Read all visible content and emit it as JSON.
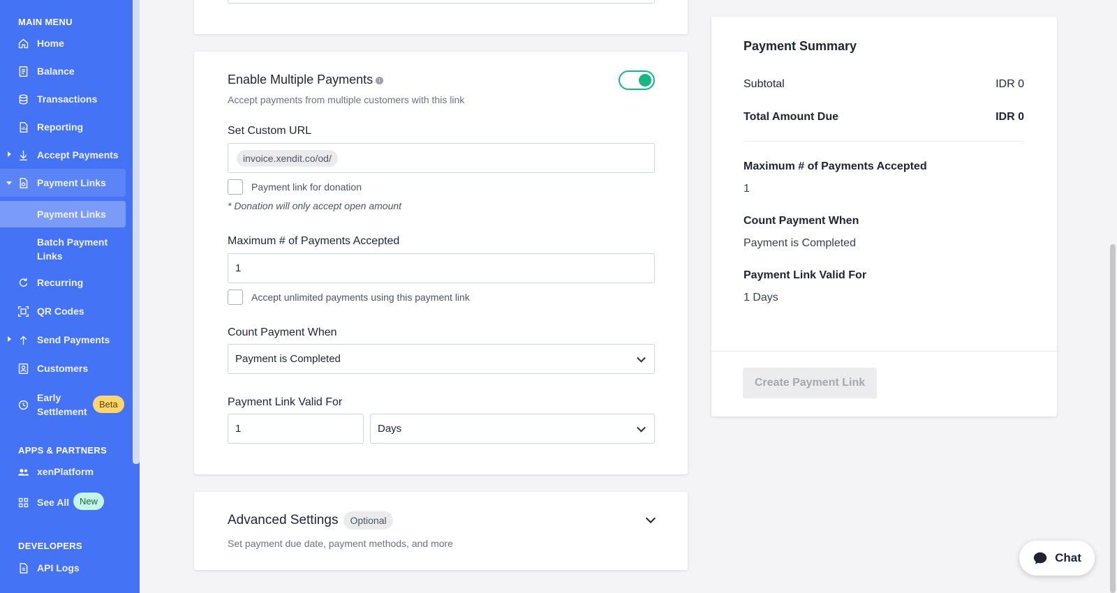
{
  "sidebar": {
    "main_menu_title": "MAIN MENU",
    "items": [
      {
        "label": "Home",
        "icon": "home-icon"
      },
      {
        "label": "Balance",
        "icon": "balance-icon"
      },
      {
        "label": "Transactions",
        "icon": "transactions-icon"
      },
      {
        "label": "Reporting",
        "icon": "reporting-icon"
      },
      {
        "label": "Accept Payments",
        "icon": "accept-payments-icon"
      },
      {
        "label": "Payment Links",
        "icon": "payment-links-icon"
      },
      {
        "label": "Recurring",
        "icon": "recurring-icon"
      },
      {
        "label": "QR Codes",
        "icon": "qr-code-icon"
      },
      {
        "label": "Send Payments",
        "icon": "send-payments-icon"
      },
      {
        "label": "Customers",
        "icon": "customers-icon"
      },
      {
        "label": "Early Settlement",
        "icon": "early-settlement-icon",
        "badge": "Beta"
      }
    ],
    "sub_items": [
      {
        "label": "Payment Links"
      },
      {
        "label": "Batch Payment Links"
      }
    ],
    "apps_title": "APPS & PARTNERS",
    "apps_items": [
      {
        "label": "xenPlatform",
        "icon": "users-icon"
      },
      {
        "label": "See All",
        "icon": "grid-icon",
        "badge": "New"
      }
    ],
    "developers_title": "DEVELOPERS",
    "developer_items": [
      {
        "label": "API Logs",
        "icon": "api-logs-icon"
      }
    ]
  },
  "form": {
    "multiple_payments": {
      "title": "Enable Multiple Payments",
      "description": "Accept payments from multiple customers with this link",
      "enabled": true
    },
    "custom_url": {
      "label": "Set Custom URL",
      "prefix": "invoice.xendit.co/od/",
      "value": ""
    },
    "donation": {
      "checkbox_label": "Payment link for donation",
      "note": "* Donation will only accept open amount",
      "checked": false
    },
    "max_payments": {
      "label": "Maximum # of Payments Accepted",
      "value": "1",
      "unlimited_label": "Accept unlimited payments using this payment link",
      "unlimited_checked": false
    },
    "count_payment": {
      "label": "Count Payment When",
      "selected": "Payment is Completed"
    },
    "valid_for": {
      "label": "Payment Link Valid For",
      "value": "1",
      "unit": "Days"
    },
    "advanced": {
      "title": "Advanced Settings",
      "pill": "Optional",
      "description": "Set payment due date, payment methods, and more"
    }
  },
  "summary": {
    "title": "Payment Summary",
    "subtotal_label": "Subtotal",
    "subtotal_value": "IDR 0",
    "total_label": "Total Amount Due",
    "total_value": "IDR 0",
    "max_label": "Maximum # of Payments Accepted",
    "max_value": "1",
    "count_label": "Count Payment When",
    "count_value": "Payment is Completed",
    "valid_label": "Payment Link Valid For",
    "valid_value": "1 Days",
    "create_button": "Create Payment Link"
  },
  "chat": {
    "label": "Chat"
  },
  "colors": {
    "sidebar": "#4573f5",
    "toggle_on": "#14b884",
    "beta_badge": "#ffd66b",
    "new_badge": "#c4f5e6"
  }
}
